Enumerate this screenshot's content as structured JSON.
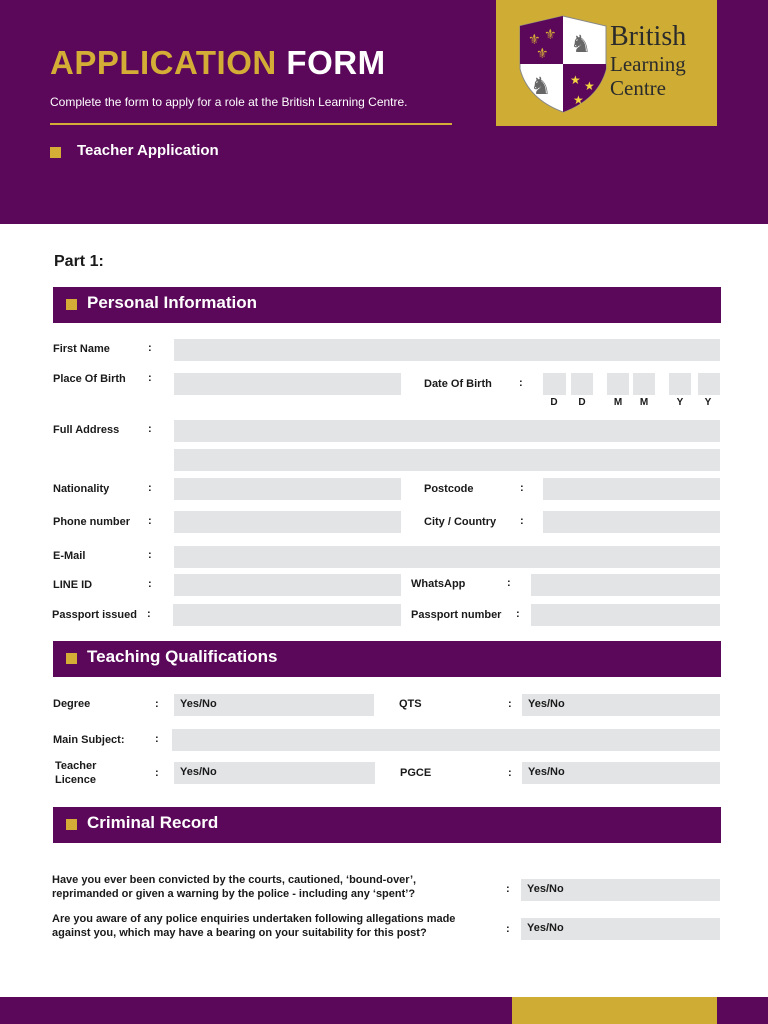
{
  "header": {
    "title_accent": "APPLICATION",
    "title_rest": "FORM",
    "subtitle": "Complete the form to apply for a role at the British Learning Centre.",
    "application_type": "Teacher Application"
  },
  "logo": {
    "line1": "British",
    "line2": "Learning",
    "line3": "Centre"
  },
  "part_label": "Part 1:",
  "personal": {
    "heading": "Personal Information",
    "first_name": "First Name",
    "place_of_birth": "Place Of Birth",
    "date_of_birth": "Date Of Birth",
    "dob_labels": [
      "D",
      "D",
      "M",
      "M",
      "Y",
      "Y"
    ],
    "full_address": "Full Address",
    "nationality": "Nationality",
    "postcode": "Postcode",
    "phone": "Phone number",
    "city_country": "City / Country",
    "email": "E-Mail",
    "line_id": "LINE ID",
    "whatsapp": "WhatsApp",
    "passport_issued": "Passport issued",
    "passport_number": "Passport number"
  },
  "qualifications": {
    "heading": "Teaching Qualifications",
    "degree": "Degree",
    "degree_value": "Yes/No",
    "qts": "QTS",
    "qts_value": "Yes/No",
    "main_subject": "Main Subject:",
    "teacher_licence_1": "Teacher",
    "teacher_licence_2": "Licence",
    "licence_value": "Yes/No",
    "pgce": "PGCE",
    "pgce_value": "Yes/No"
  },
  "criminal": {
    "heading": "Criminal Record",
    "q1_line1": "Have you ever been convicted by the courts, cautioned, ‘bound-over’,",
    "q1_line2": "reprimanded or given a warning by the police - including any ‘spent’?",
    "q1_value": "Yes/No",
    "q2_line1": "Are you aware of any police enquiries undertaken following allegations made",
    "q2_line2": "against you, which may have a bearing on your suitability for this post?",
    "q2_value": "Yes/No"
  },
  "colon": ":",
  "colors": {
    "purple": "#5b075a",
    "gold": "#d3ad35",
    "field": "#e2e4e6"
  }
}
